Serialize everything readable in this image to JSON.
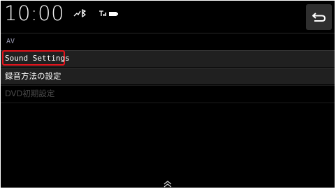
{
  "status_bar": {
    "time": "10:00",
    "icons": [
      "bluetooth-icon",
      "signal-icon",
      "battery-icon"
    ]
  },
  "header": {
    "back_icon": "return-arrow-icon"
  },
  "section": {
    "label": "AV"
  },
  "menu": {
    "items": [
      {
        "label": "Sound Settings",
        "enabled": true,
        "highlighted": true
      },
      {
        "label": "録音方法の設定",
        "enabled": true,
        "highlighted": false
      },
      {
        "label": "DVD初期設定",
        "enabled": false,
        "highlighted": false
      }
    ]
  },
  "footer": {
    "scroll_icon": "double-chevron-up-icon"
  },
  "colors": {
    "background": "#000000",
    "row": "#202020",
    "highlight": "#e5141c",
    "section_label": "#9a9ab2",
    "disabled_text": "#4a4a4a"
  }
}
